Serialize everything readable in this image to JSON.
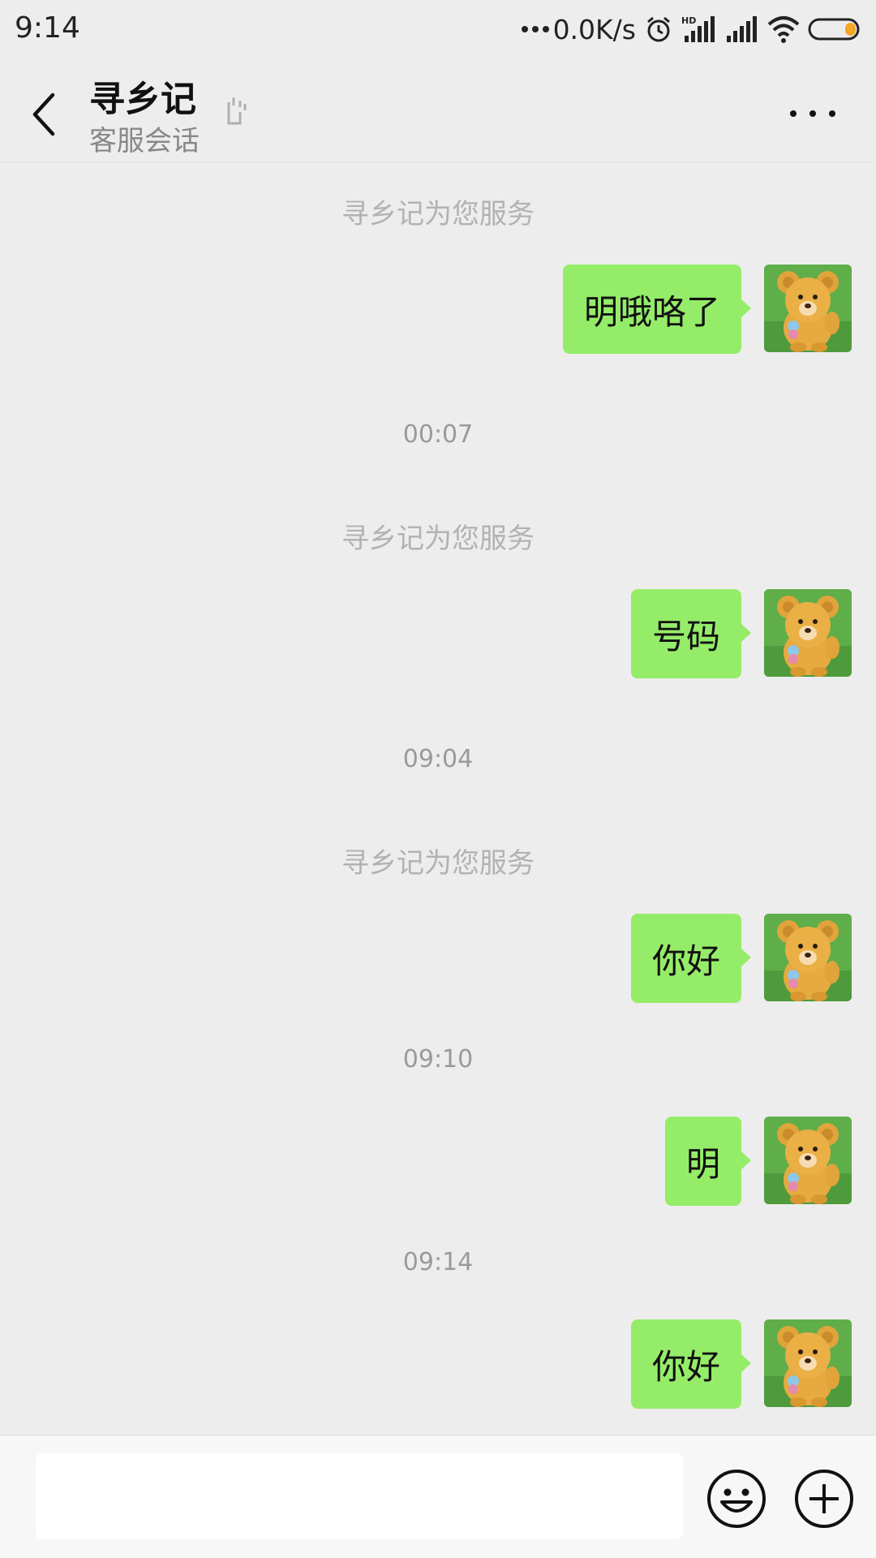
{
  "status_bar": {
    "time": "9:14",
    "net_speed": "0.0K/s",
    "hd_label": "HD"
  },
  "header": {
    "title": "寻乡记",
    "subtitle": "客服会话"
  },
  "conversation": {
    "service_notice_1": "寻乡记为您服务",
    "message_1": "明哦咯了",
    "timestamp_1": "00:07",
    "service_notice_2": "寻乡记为您服务",
    "message_2": "号码",
    "timestamp_2": "09:04",
    "service_notice_3": "寻乡记为您服务",
    "message_3": "你好",
    "timestamp_3": "09:10",
    "message_4": "明",
    "timestamp_4": "09:14",
    "message_5": "你好"
  },
  "input_bar": {
    "value": "",
    "emoji_icon": "smiley-face-icon",
    "more_icon": "plus-circle-icon"
  },
  "colors": {
    "background": "#ededed",
    "outgoing_bubble": "#95ec69",
    "system_text": "#b2b2b2",
    "input_bar": "#f7f7f7"
  }
}
